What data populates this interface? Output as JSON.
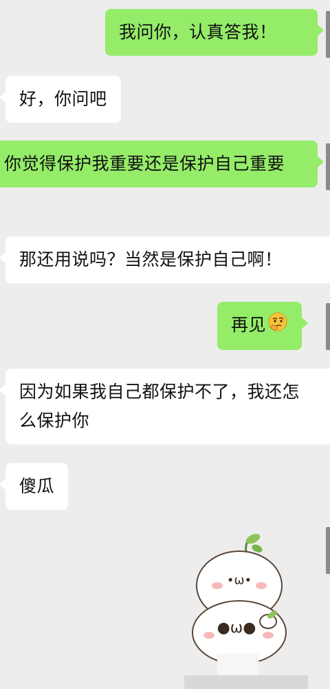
{
  "messages": [
    {
      "side": "right",
      "text": "我问你，认真答我！"
    },
    {
      "side": "left",
      "text": "好，你问吧"
    },
    {
      "side": "right",
      "text": "你觉得保护我重要还是保护自己重要"
    },
    {
      "side": "left",
      "text": "那还用说吗？当然是保护自己啊！"
    },
    {
      "side": "right",
      "text": "再见",
      "emoji": "thinking-face-icon"
    },
    {
      "side": "left",
      "text": "因为如果我自己都保护不了，我还怎么保护你"
    },
    {
      "side": "left",
      "text": "傻瓜"
    }
  ],
  "sticker": {
    "name": "cute-dumpling-sticker",
    "face_text": "•ω•"
  },
  "colors": {
    "background": "#ededed",
    "sent": "#95ec69",
    "received": "#ffffff"
  }
}
